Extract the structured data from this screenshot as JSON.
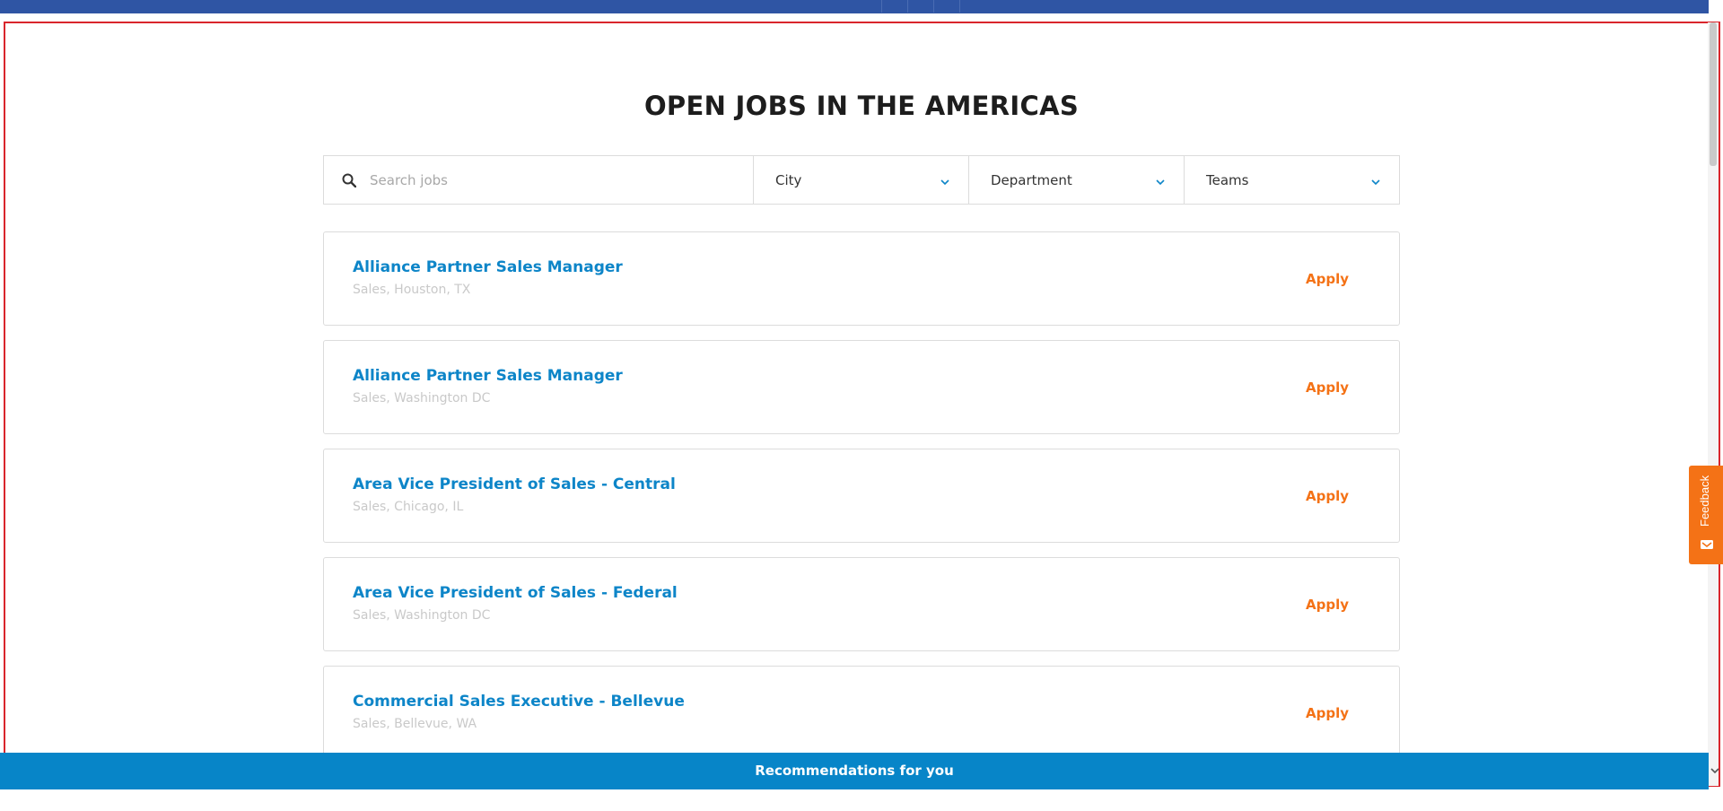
{
  "page": {
    "title": "OPEN JOBS IN THE AMERICAS"
  },
  "search": {
    "placeholder": "Search jobs",
    "value": ""
  },
  "filters": {
    "city": "City",
    "department": "Department",
    "teams": "Teams"
  },
  "jobs": [
    {
      "title": "Alliance Partner Sales Manager",
      "meta": "Sales, Houston, TX",
      "action": "Apply"
    },
    {
      "title": "Alliance Partner Sales Manager",
      "meta": "Sales, Washington DC",
      "action": "Apply"
    },
    {
      "title": "Area Vice President of Sales - Central",
      "meta": "Sales, Chicago, IL",
      "action": "Apply"
    },
    {
      "title": "Area Vice President of Sales - Federal",
      "meta": "Sales, Washington DC",
      "action": "Apply"
    },
    {
      "title": "Commercial Sales Executive - Bellevue",
      "meta": "Sales, Bellevue, WA",
      "action": "Apply"
    }
  ],
  "recommendations": {
    "label": "Recommendations for you"
  },
  "feedback": {
    "label": "Feedback"
  },
  "icons": {
    "search": "search-icon",
    "chevron": "chevron-down-icon",
    "feedback": "feedback-icon"
  },
  "colors": {
    "brand_blue": "#0785c8",
    "job_title": "#0d85c8",
    "apply": "#f47216",
    "top_bar": "#2f55a4",
    "frame": "#d9262c"
  }
}
